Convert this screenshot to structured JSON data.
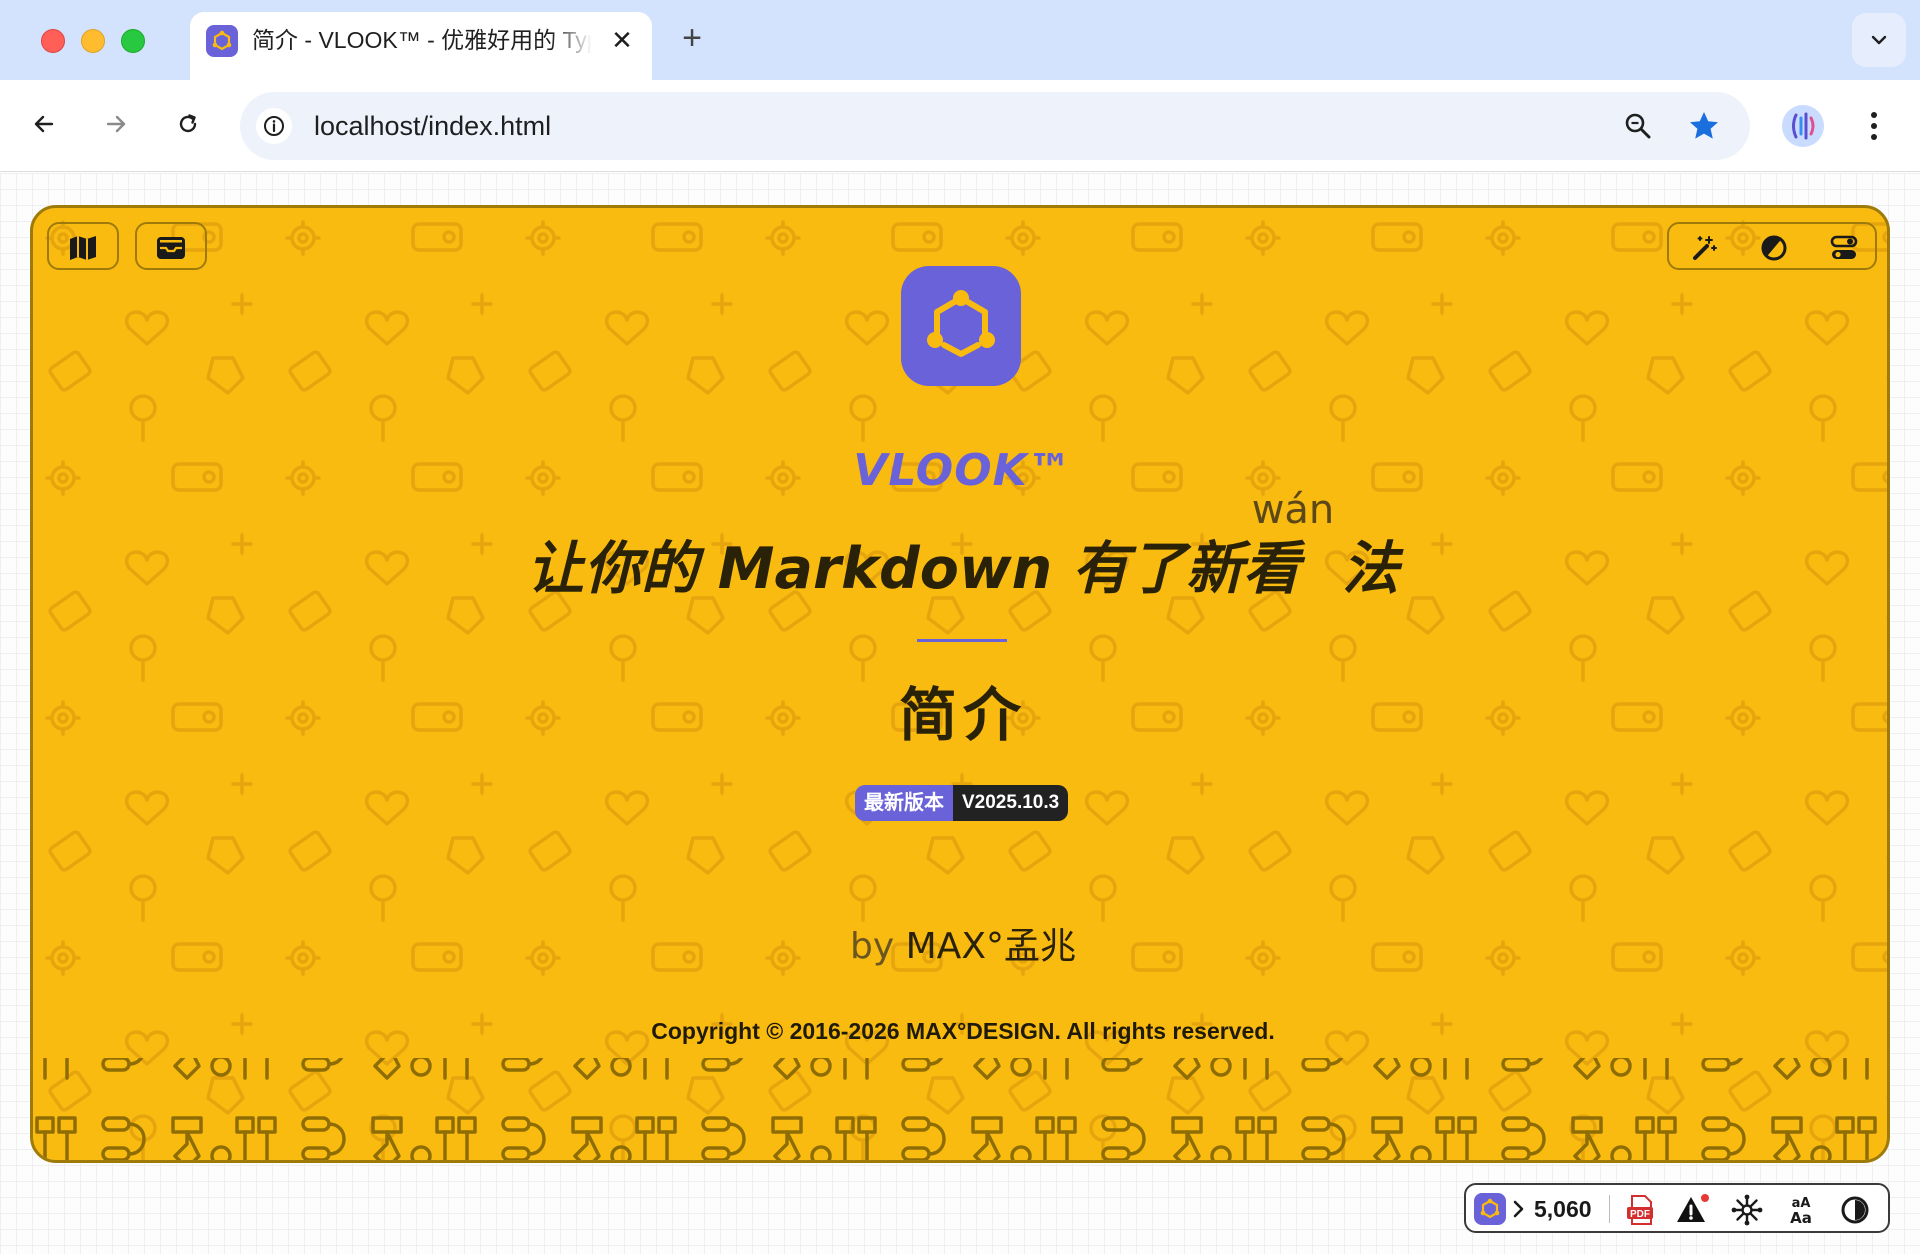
{
  "browser": {
    "tab_title": "简介 - VLOOK™ - 优雅好用的 Typora/Markdown 主题包和增强插件",
    "url": "localhost/index.html",
    "close_glyph": "✕",
    "new_tab_glyph": "+"
  },
  "cover": {
    "brand": "VLOOK™",
    "slogan": "让你的 Markdown 有了新看法",
    "slogan_parts": {
      "main": "让你的 Markdown 有了新",
      "kan": "看",
      "fa": "法"
    },
    "ruby": "wán",
    "section_title": "简介",
    "version": {
      "label": "最新版本",
      "value": "V2025.10.3"
    },
    "author": {
      "by": "by",
      "name": "MAX°孟兆"
    },
    "copyright": "Copyright © 2016-2026 MAX°DESIGN. All rights reserved."
  },
  "statusbar": {
    "word_count": "5,060",
    "pdf_label": "PDF",
    "font_label_top": "aA",
    "font_label_bottom": "Aa",
    "accent_color": "#6a62d8",
    "alert_dot_color": "#e53935"
  },
  "theme": {
    "cover_bg": "#f9bb10",
    "accent": "#6a62d8",
    "text_dark": "#2a2208"
  }
}
